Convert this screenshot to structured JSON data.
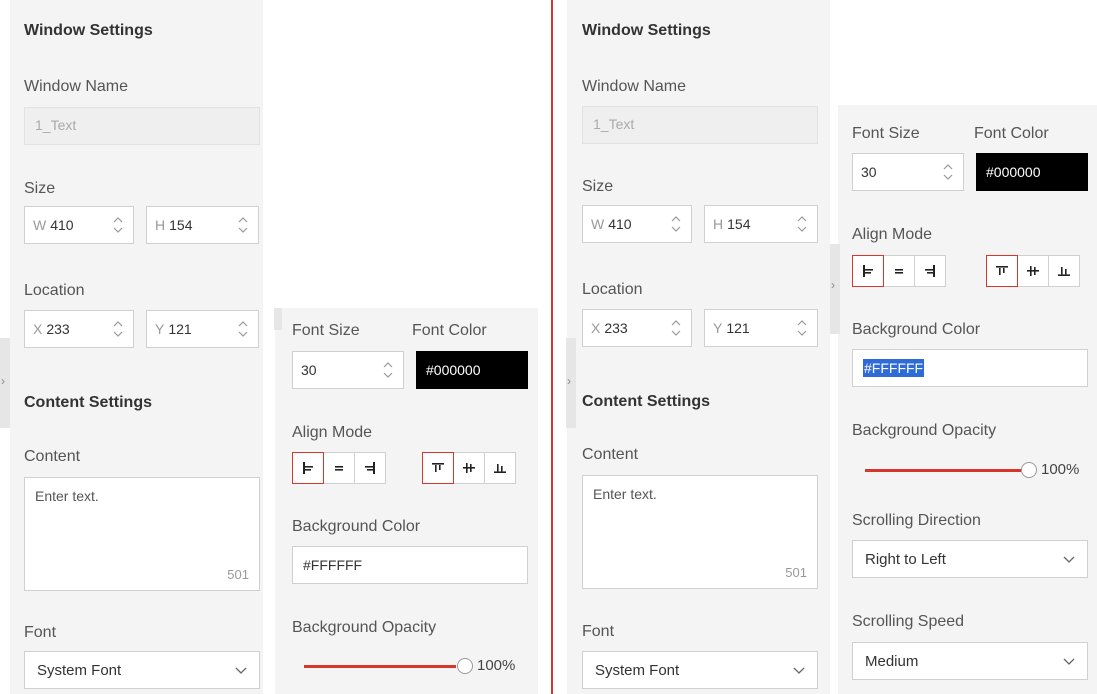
{
  "left": {
    "window_settings_title": "Window Settings",
    "window_name_label": "Window Name",
    "window_name_value": "1_Text",
    "size_label": "Size",
    "width_prefix": "W",
    "width_value": "410",
    "height_prefix": "H",
    "height_value": "154",
    "location_label": "Location",
    "x_prefix": "X",
    "x_value": "233",
    "y_prefix": "Y",
    "y_value": "121",
    "content_settings_title": "Content Settings",
    "content_label": "Content",
    "content_placeholder": "Enter text.",
    "content_counter": "501",
    "font_label": "Font",
    "font_value": "System Font",
    "font_size_label": "Font Size",
    "font_size_value": "30",
    "font_color_label": "Font Color",
    "font_color_value": "#000000",
    "align_mode_label": "Align Mode",
    "background_color_label": "Background Color",
    "background_color_value": "#FFFFFF",
    "background_opacity_label": "Background Opacity",
    "background_opacity_value": "100%"
  },
  "right": {
    "window_settings_title": "Window Settings",
    "window_name_label": "Window Name",
    "window_name_value": "1_Text",
    "size_label": "Size",
    "width_prefix": "W",
    "width_value": "410",
    "height_prefix": "H",
    "height_value": "154",
    "location_label": "Location",
    "x_prefix": "X",
    "x_value": "233",
    "y_prefix": "Y",
    "y_value": "121",
    "content_settings_title": "Content Settings",
    "content_label": "Content",
    "content_placeholder": "Enter text.",
    "content_counter": "501",
    "font_label": "Font",
    "font_value": "System Font",
    "font_size_label": "Font Size",
    "font_size_value": "30",
    "font_color_label": "Font Color",
    "font_color_value": "#000000",
    "align_mode_label": "Align Mode",
    "background_color_label": "Background Color",
    "background_color_value": "#FFFFFF",
    "background_opacity_label": "Background Opacity",
    "background_opacity_value": "100%",
    "scrolling_direction_label": "Scrolling Direction",
    "scrolling_direction_value": "Right to Left",
    "scrolling_speed_label": "Scrolling Speed",
    "scrolling_speed_value": "Medium"
  },
  "colors": {
    "accent": "#d9362b",
    "panel_bg": "#f4f4f4",
    "selection": "#2f6bd7"
  },
  "icons": {
    "spinner": "chevron-up-down-icon",
    "dropdown": "chevron-down-icon",
    "align": [
      "align-left-icon",
      "align-center-icon",
      "align-right-icon",
      "align-top-icon",
      "align-middle-icon",
      "align-bottom-icon"
    ],
    "panel_toggle": "chevron-right-icon"
  },
  "state": {
    "opacity_fraction": 1.0,
    "active_horizontal_align": "left",
    "active_vertical_align": "top"
  }
}
